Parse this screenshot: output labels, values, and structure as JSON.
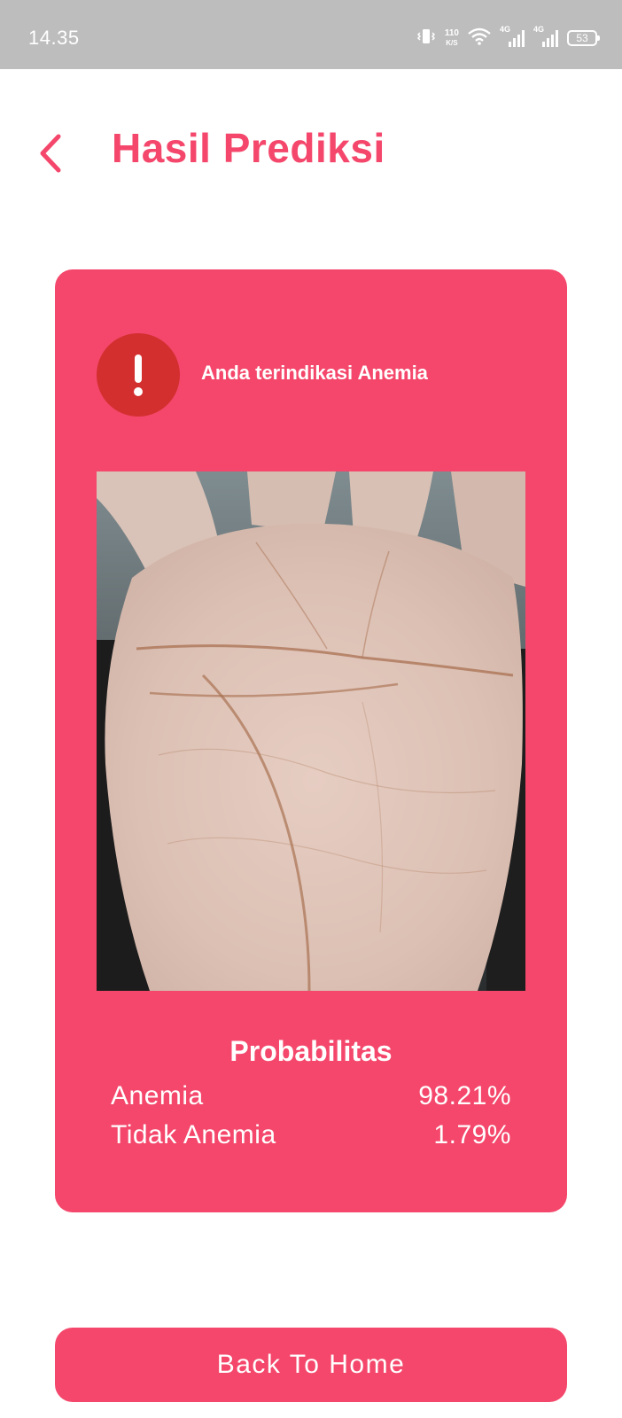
{
  "status_bar": {
    "time": "14.35",
    "net_speed_value": "110",
    "net_speed_unit": "K/S",
    "signal_1_label": "4G",
    "signal_2_label": "4G",
    "battery_level": "53",
    "icons": [
      "vibrate-icon",
      "wifi-icon",
      "signal-icon",
      "battery-icon"
    ]
  },
  "header": {
    "title": "Hasil Prediksi",
    "back_icon": "chevron-left-icon"
  },
  "result": {
    "alert_icon": "exclamation-icon",
    "message": "Anda terindikasi Anemia",
    "image_subject": "palm-photo",
    "probability_title": "Probabilitas",
    "rows": [
      {
        "label": "Anemia",
        "value": "98.21%"
      },
      {
        "label": "Tidak Anemia",
        "value": "1.79%"
      }
    ]
  },
  "actions": {
    "home_button_label": "Back To Home"
  },
  "colors": {
    "accent": "#f4476b",
    "alert": "#d32f2f",
    "status_bar": "#bdbdbd"
  }
}
